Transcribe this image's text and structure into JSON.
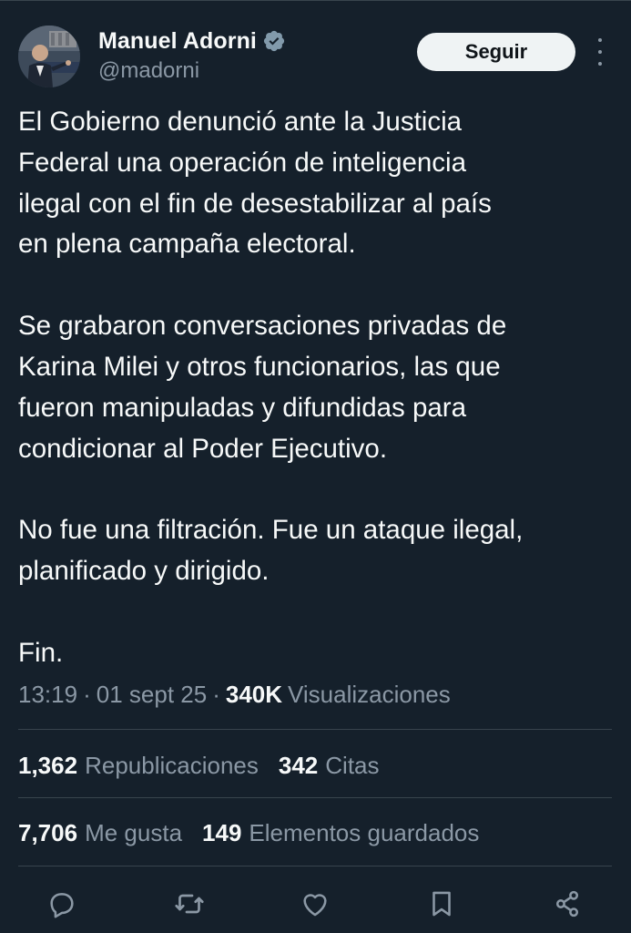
{
  "author": {
    "name": "Manuel Adorni",
    "handle": "@madorni",
    "verified_icon": "verified-badge-icon"
  },
  "header": {
    "follow_label": "Seguir",
    "more_icon": "more-vertical-icon"
  },
  "tweet": {
    "paragraphs": [
      [
        "El Gobierno denunció ante la Justicia",
        "Federal una operación de inteligencia",
        "ilegal con el fin de desestabilizar al país",
        "en plena campaña electoral."
      ],
      [
        "Se grabaron conversaciones privadas de",
        "Karina Milei y otros funcionarios, las que",
        "fueron manipuladas y difundidas para",
        "condicionar al Poder Ejecutivo."
      ],
      [
        "No fue una filtración. Fue un ataque ilegal,",
        "planificado y dirigido."
      ],
      [
        "Fin."
      ]
    ]
  },
  "meta": {
    "time": "13:19",
    "separator": "·",
    "date": "01 sept 25",
    "views_count": "340K",
    "views_label": "Visualizaciones"
  },
  "stats": {
    "reposts_count": "1,362",
    "reposts_label": "Republicaciones",
    "quotes_count": "342",
    "quotes_label": "Citas",
    "likes_count": "7,706",
    "likes_label": "Me gusta",
    "bookmarks_count": "149",
    "bookmarks_label": "Elementos guardados"
  },
  "actions": [
    "reply-icon",
    "repost-icon",
    "like-icon",
    "bookmark-icon",
    "share-icon"
  ],
  "colors": {
    "background": "#15202b",
    "text": "#f7f9f9",
    "secondary": "#8b98a5",
    "divider": "#38444d",
    "verified": "#829aab"
  }
}
